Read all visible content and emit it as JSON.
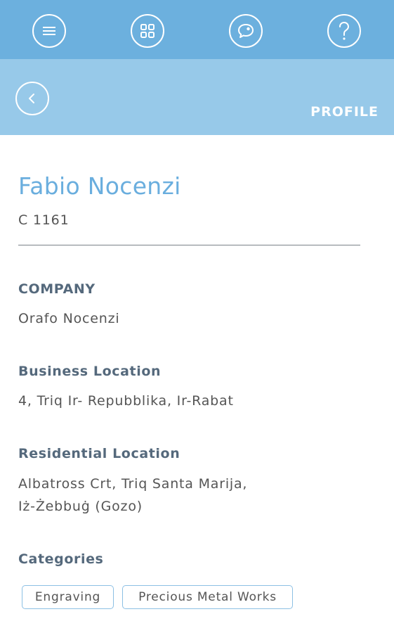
{
  "toolbar": {
    "icons": [
      "menu-icon",
      "grid-icon",
      "chat-icon",
      "help-icon"
    ]
  },
  "header": {
    "title": "PROFILE",
    "back_icon": "chevron-left-icon"
  },
  "profile": {
    "name": "Fabio Nocenzi",
    "code": "C 1161",
    "company_label": "COMPANY",
    "company": "Orafo Nocenzi",
    "business_label": "Business Location",
    "business": "4, Triq Ir- Repubblika, Ir-Rabat",
    "residential_label": "Residential Location",
    "residential_line1": "Albatross Crt, Triq Santa Marija,",
    "residential_line2": "Iż-Żebbuġ (Gozo)",
    "categories_label": "Categories",
    "categories": [
      "Engraving",
      "Precious Metal Works"
    ]
  },
  "colors": {
    "topbar": "#6cb0de",
    "subbar": "#97c9e9",
    "accent": "#6aaede"
  }
}
